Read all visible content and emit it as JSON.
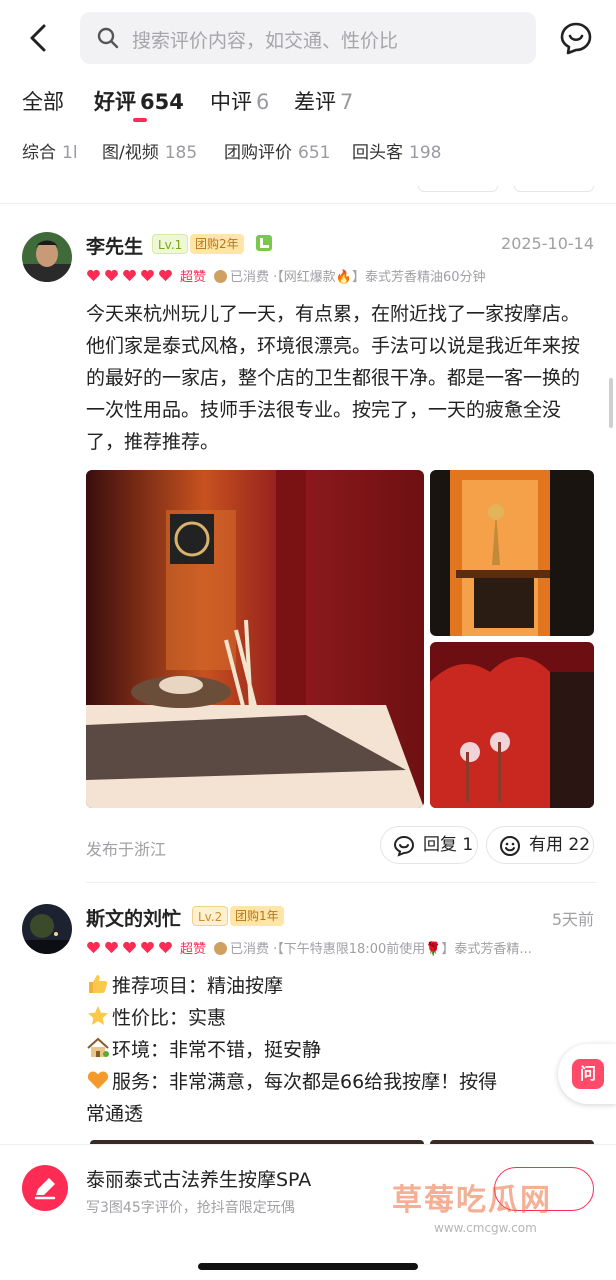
{
  "header": {
    "search_placeholder": "搜索评价内容，如交通、性价比"
  },
  "tabs": [
    {
      "label": "全部",
      "count": ""
    },
    {
      "label": "好评",
      "count": "654"
    },
    {
      "label": "中评",
      "count": "6"
    },
    {
      "label": "差评",
      "count": "7"
    }
  ],
  "filters": [
    {
      "label": "综合",
      "count": "1l"
    },
    {
      "label": "图/视频",
      "count": "185"
    },
    {
      "label": "团购评价",
      "count": "651"
    },
    {
      "label": "回头客",
      "count": "198"
    }
  ],
  "reviews": [
    {
      "name": "李先生",
      "level": "Lv.1",
      "tag": "团购2年",
      "date": "2025-10-14",
      "rating_label": "超赞",
      "consumed": "已消费 ·【网红爆款🔥】泰式芳香精油60分钟",
      "text": "今天来杭州玩儿了一天，有点累，在附近找了一家按摩店。他们家是泰式风格，环境很漂亮。手法可以说是我近年来按的最好的一家店，整个店的卫生都很干净。都是一客一换的一次性用品。技师手法很专业。按完了，一天的疲惫全没了，推荐推荐。",
      "location": "发布于浙江",
      "reply_label": "回复 1",
      "useful_label": "有用 22"
    },
    {
      "name": "斯文的刘忙",
      "level": "Lv.2",
      "tag": "团购1年",
      "date": "5天前",
      "rating_label": "超赞",
      "consumed": "已消费 ·【下午特惠限18:00前使用🌹】泰式芳香精...",
      "lines": [
        "推荐项目：精油按摩",
        "性价比：实惠",
        "环境：非常不错，挺安静",
        "服务：非常满意，每次都是66给我按摩！按得",
        "常通透"
      ]
    }
  ],
  "ask_label": "问",
  "bottom": {
    "title": "泰丽泰式古法养生按摩SPA",
    "subtitle": "写3图45字评价，抢抖音限定玩偶"
  },
  "watermark": {
    "text": "草莓吃瓜网",
    "url": "www.cmcgw.com"
  },
  "colors": {
    "accent": "#fe2c55",
    "muted": "#a0a0a5"
  }
}
